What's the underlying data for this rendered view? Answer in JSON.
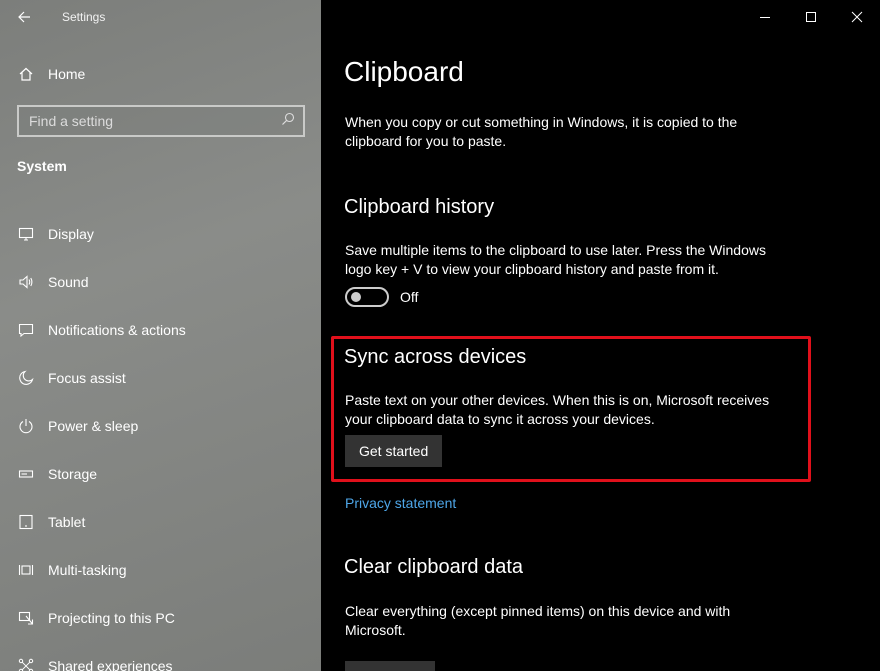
{
  "app": {
    "title": "Settings"
  },
  "sidebar": {
    "home_label": "Home",
    "search_placeholder": "Find a setting",
    "section": "System",
    "items": [
      {
        "label": "Display",
        "icon": "display-icon"
      },
      {
        "label": "Sound",
        "icon": "sound-icon"
      },
      {
        "label": "Notifications & actions",
        "icon": "notifications-icon"
      },
      {
        "label": "Focus assist",
        "icon": "moon-icon"
      },
      {
        "label": "Power & sleep",
        "icon": "power-icon"
      },
      {
        "label": "Storage",
        "icon": "storage-icon"
      },
      {
        "label": "Tablet",
        "icon": "tablet-icon"
      },
      {
        "label": "Multi-tasking",
        "icon": "multitasking-icon"
      },
      {
        "label": "Projecting to this PC",
        "icon": "projecting-icon"
      },
      {
        "label": "Shared experiences",
        "icon": "shared-experiences-icon"
      }
    ]
  },
  "main": {
    "title": "Clipboard",
    "intro": "When you copy or cut something in Windows, it is copied to the clipboard for you to paste.",
    "history": {
      "heading": "Clipboard history",
      "description": "Save multiple items to the clipboard to use later. Press the Windows logo key + V to view your clipboard history and paste from it.",
      "toggle_state": "Off"
    },
    "sync": {
      "heading": "Sync across devices",
      "description": "Paste text on your other devices. When this is on, Microsoft receives your clipboard data to sync it across your devices.",
      "button": "Get started",
      "privacy_link": "Privacy statement"
    },
    "clear": {
      "heading": "Clear clipboard data",
      "description": "Clear everything (except pinned items) on this device and with Microsoft."
    }
  },
  "colors": {
    "highlight": "#e0101b",
    "link": "#4ea6e8",
    "button_bg": "#333333"
  }
}
